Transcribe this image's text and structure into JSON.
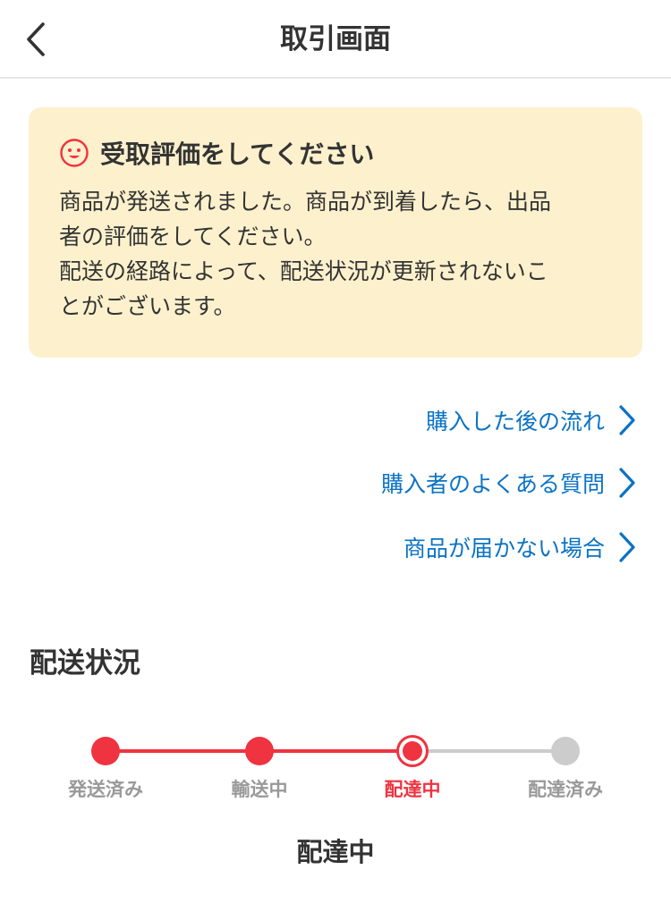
{
  "header": {
    "title": "取引画面",
    "back_icon": "chevron-left-icon"
  },
  "notice": {
    "icon": "smile-face-icon",
    "title": "受取評価をしてください",
    "lines": [
      "商品が発送されました。商品が到着したら、出品",
      "者の評価をしてください。",
      "配送の経路によって、配送状況が更新されないこ",
      "とがございます。"
    ]
  },
  "links": [
    {
      "label": "購入した後の流れ"
    },
    {
      "label": "購入者のよくある質問"
    },
    {
      "label": "商品が届かない場合"
    }
  ],
  "shipping": {
    "section_title": "配送状況",
    "steps": [
      {
        "label": "発送済み",
        "state": "done"
      },
      {
        "label": "輸送中",
        "state": "done"
      },
      {
        "label": "配達中",
        "state": "current"
      },
      {
        "label": "配達済み",
        "state": "pending"
      }
    ],
    "current_status": "配達中"
  },
  "colors": {
    "accent_red": "#ef3340",
    "link_blue": "#0b73c4",
    "notice_bg": "#fdf1cd",
    "pending_gray": "#cccccc"
  }
}
